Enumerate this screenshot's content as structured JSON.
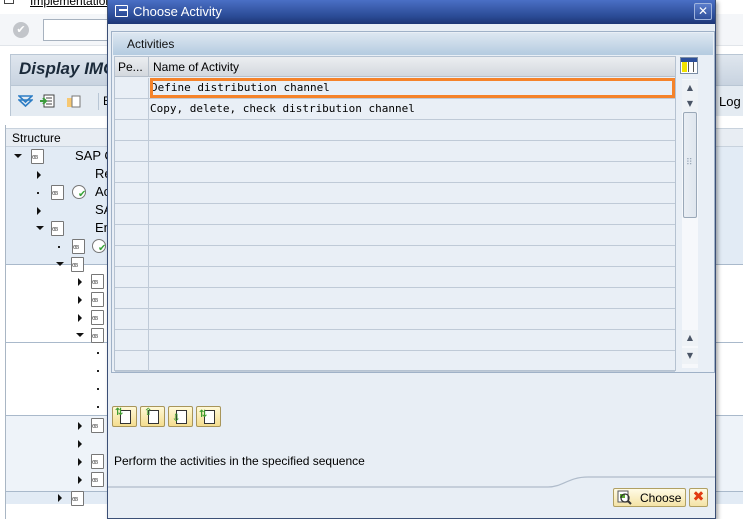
{
  "background_window": {
    "menu_label": "Implementation Guide",
    "screen_title": "Display IMG",
    "toolbar_label_partial": "E",
    "toolbar_log": "Log",
    "tree_header": "Structure",
    "tree_nodes": [
      {
        "label": "SAP C"
      },
      {
        "label": "Re"
      },
      {
        "label": "Ac"
      },
      {
        "label": "SA"
      },
      {
        "label": "En"
      }
    ]
  },
  "dialog": {
    "title": "Choose Activity",
    "group_title": "Activities",
    "table": {
      "columns": [
        "Pe...",
        "Name of Activity"
      ],
      "rows": [
        {
          "pe": "",
          "name": "Define distribution channel",
          "selected": true
        },
        {
          "pe": "",
          "name": "Copy, delete, check distribution channel",
          "selected": false
        },
        {
          "pe": "",
          "name": "",
          "selected": false
        },
        {
          "pe": "",
          "name": "",
          "selected": false
        },
        {
          "pe": "",
          "name": "",
          "selected": false
        },
        {
          "pe": "",
          "name": "",
          "selected": false
        },
        {
          "pe": "",
          "name": "",
          "selected": false
        },
        {
          "pe": "",
          "name": "",
          "selected": false
        },
        {
          "pe": "",
          "name": "",
          "selected": false
        },
        {
          "pe": "",
          "name": "",
          "selected": false
        },
        {
          "pe": "",
          "name": "",
          "selected": false
        },
        {
          "pe": "",
          "name": "",
          "selected": false
        },
        {
          "pe": "",
          "name": "",
          "selected": false
        },
        {
          "pe": "",
          "name": "",
          "selected": false
        }
      ]
    },
    "sequence_buttons": [
      {
        "icon": "move-to-top-icon"
      },
      {
        "icon": "move-up-icon"
      },
      {
        "icon": "move-down-icon"
      },
      {
        "icon": "move-to-bottom-icon"
      }
    ],
    "hint": "Perform the activities in the specified sequence",
    "choose_label": "Choose",
    "accent_color": "#f5832a"
  }
}
